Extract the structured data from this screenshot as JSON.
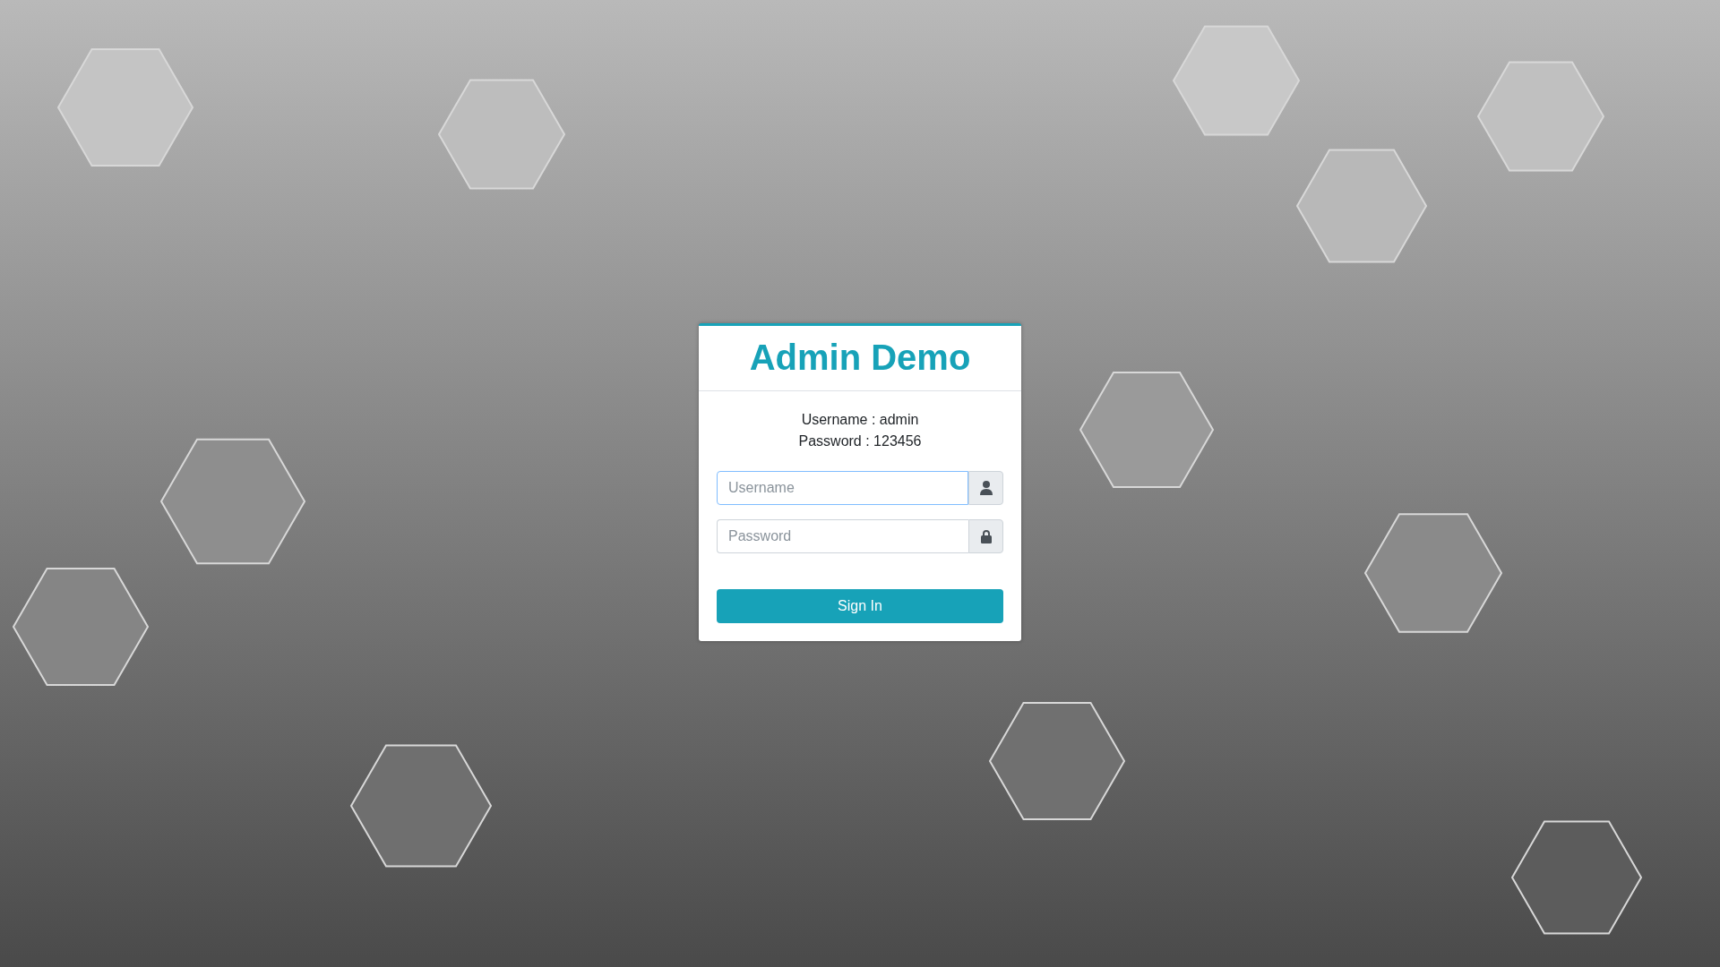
{
  "login": {
    "title": "Admin Demo",
    "hints": [
      "Username : admin",
      "Password : 123456"
    ],
    "fields": [
      {
        "kind": "user",
        "placeholder": "Username",
        "focused": true
      },
      {
        "kind": "lock",
        "placeholder": "Password",
        "focused": false
      }
    ],
    "button": "Sign In"
  }
}
